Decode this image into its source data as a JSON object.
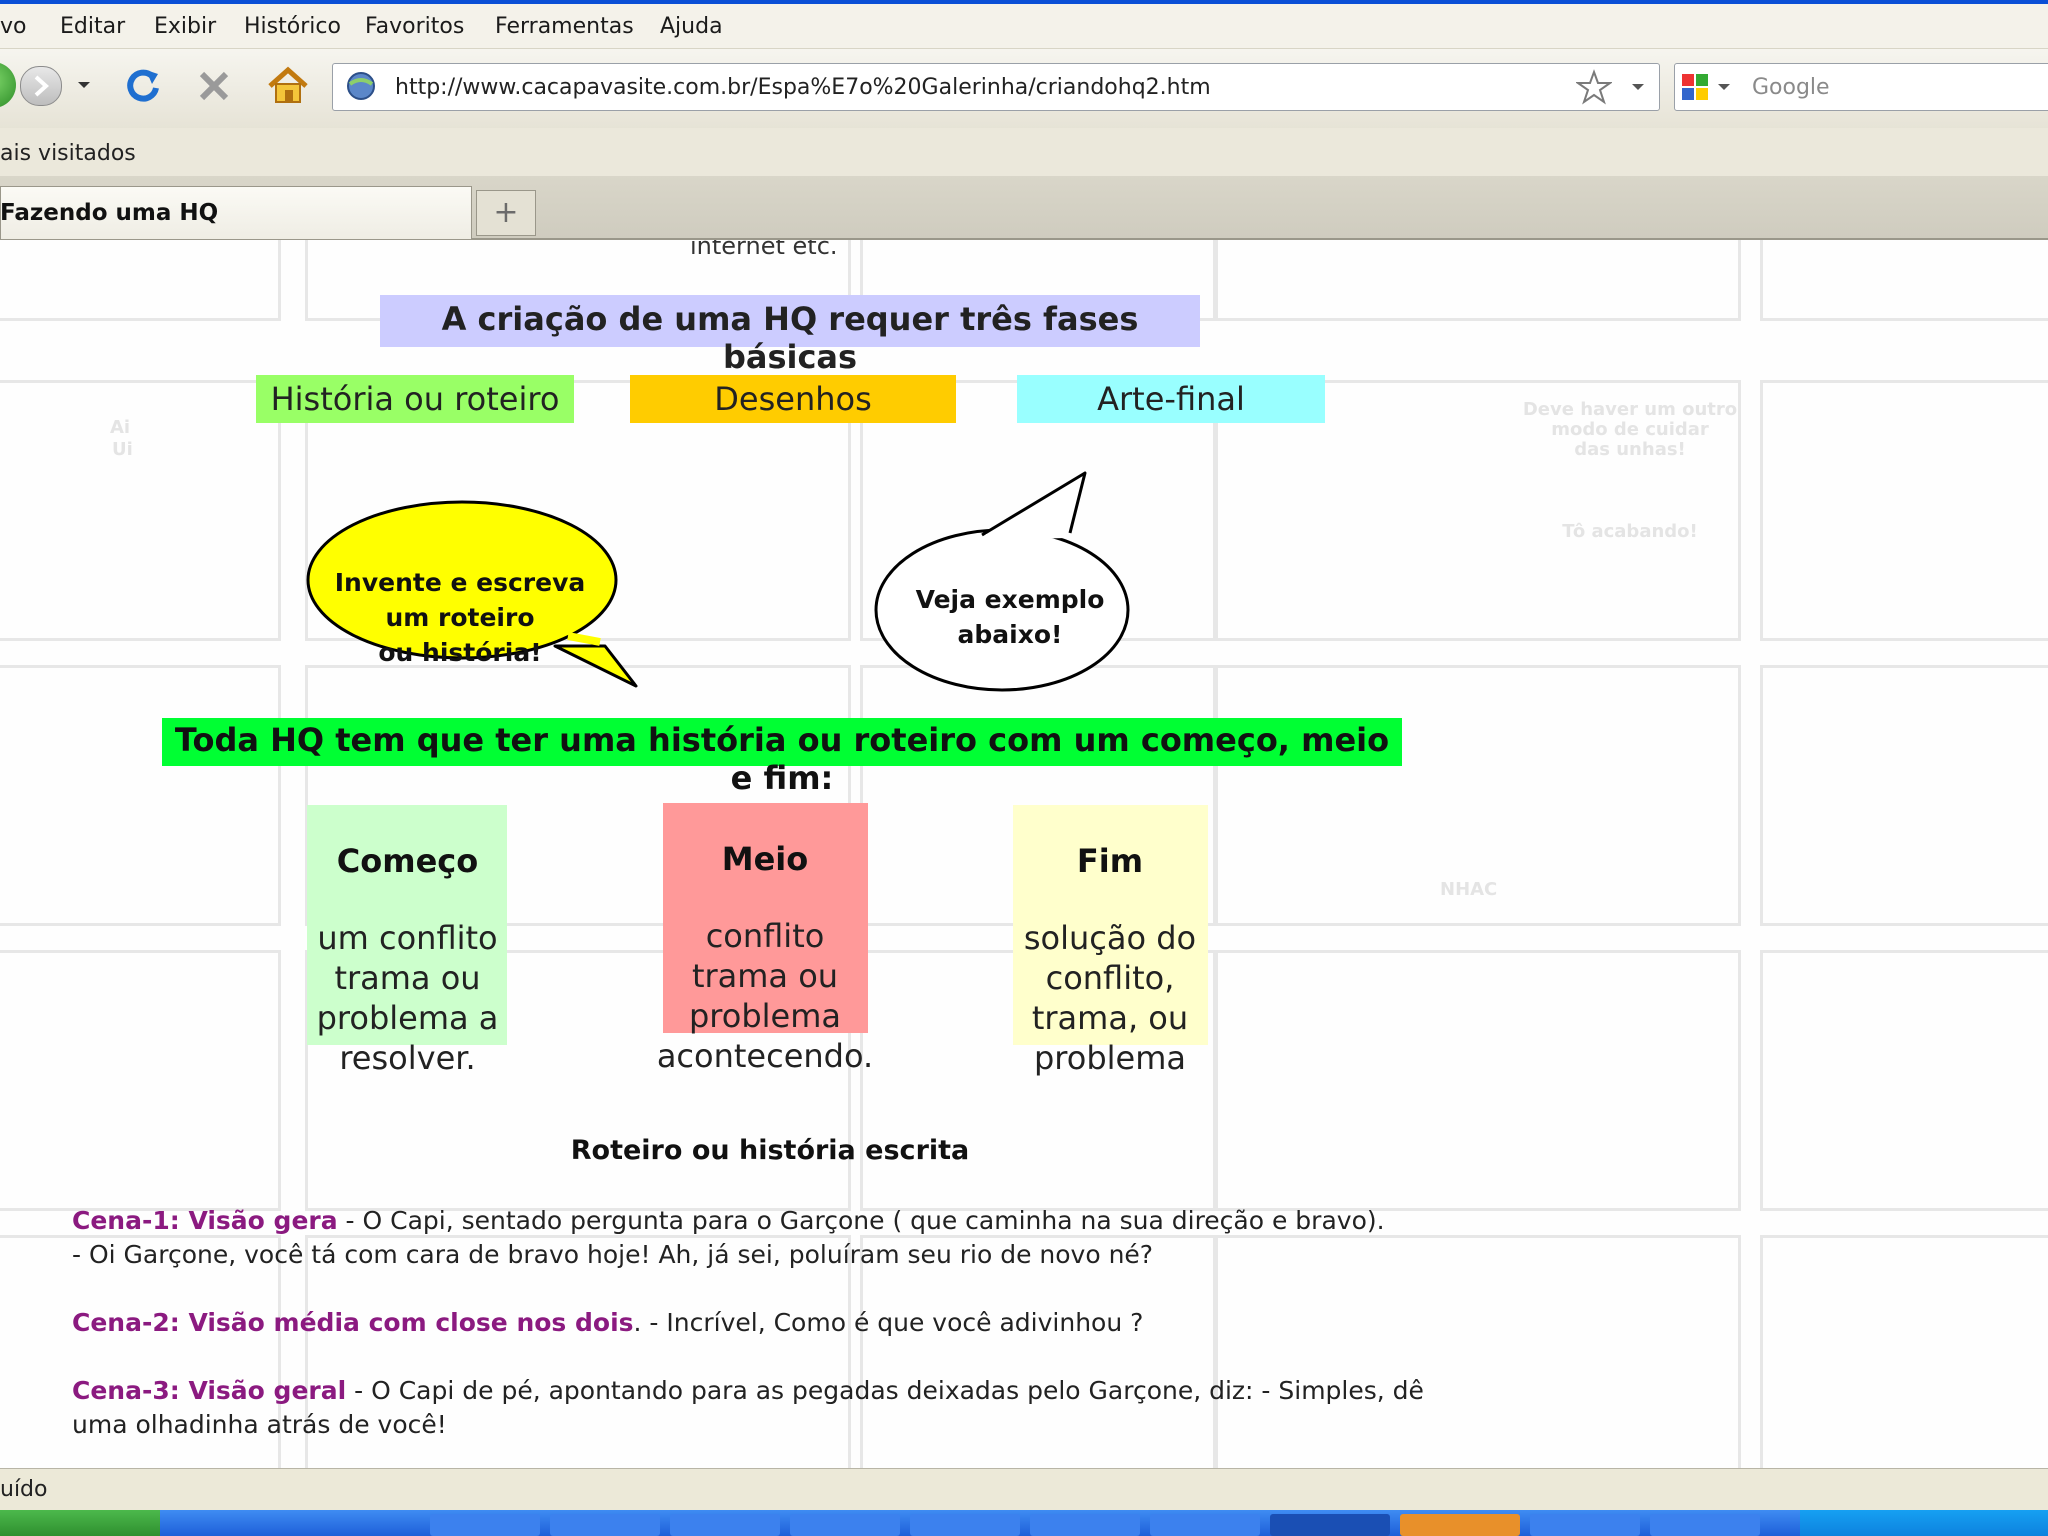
{
  "menu": [
    "vo",
    "Editar",
    "Exibir",
    "Histórico",
    "Favoritos",
    "Ferramentas",
    "Ajuda"
  ],
  "toolbar": {
    "url": "http://www.cacapavasite.com.br/Espa%E7o%20Galerinha/criandohq2.htm",
    "search_placeholder": "Google"
  },
  "bookmarks": {
    "label": "ais visitados"
  },
  "tab": {
    "title": "Fazendo uma HQ",
    "new_tab": "+"
  },
  "page": {
    "cut_text": "internet etc.",
    "header": "A criação de uma HQ requer três fases básicas",
    "phases": [
      "História ou roteiro",
      "Desenhos",
      "Arte-final"
    ],
    "bubble1": [
      "Invente e escreva",
      "um roteiro",
      "ou história!"
    ],
    "bubble2": [
      "Veja exemplo",
      "abaixo!"
    ],
    "green_banner": "Toda HQ tem que ter uma história ou roteiro com um começo, meio e fim:",
    "cards": [
      {
        "title": "Começo",
        "body": [
          "um conflito",
          "trama ou",
          "problema a",
          "resolver."
        ]
      },
      {
        "title": "Meio",
        "body": [
          "conflito",
          "trama ou",
          "problema",
          "acontecendo."
        ]
      },
      {
        "title": "Fim",
        "body": [
          "solução do",
          "conflito,",
          "trama, ou",
          "problema"
        ]
      }
    ],
    "roteiro_title": "Roteiro ou história escrita",
    "scenes": [
      {
        "label": "Cena-1: Visão gera",
        "text": " - O Capi, sentado pergunta para o Garçone ( que caminha na sua direção e bravo).",
        "text2": "- Oi Garçone, você tá com cara de bravo hoje! Ah, já sei, poluíram seu rio de novo né?"
      },
      {
        "label": "Cena-2: Visão média com close nos dois",
        "text": ". - Incrível, Como é que você adivinhou ?",
        "text2": ""
      },
      {
        "label": "Cena-3: Visão geral",
        "text": " - O Capi de pé, apontando para as pegadas deixadas pelo Garçone, diz: - Simples, dê",
        "text2": "uma olhadinha atrás de você!"
      }
    ],
    "watermark": [
      "Ai",
      "Ui",
      "Deve haver um outro",
      "modo de cuidar",
      "das unhas!",
      "Tô acabando!",
      "NHAC"
    ]
  },
  "status": {
    "text": "uído"
  },
  "colors": {
    "header_bg": "#ccccff",
    "phase1": "#99ff66",
    "phase2": "#ffcc00",
    "phase3": "#99ffff",
    "bubble1": "#ffff00",
    "green_banner": "#00ff33",
    "card1": "#ccffcc",
    "card2": "#ff9999",
    "card3": "#ffffcc",
    "scene_label": "#8b1a80"
  }
}
